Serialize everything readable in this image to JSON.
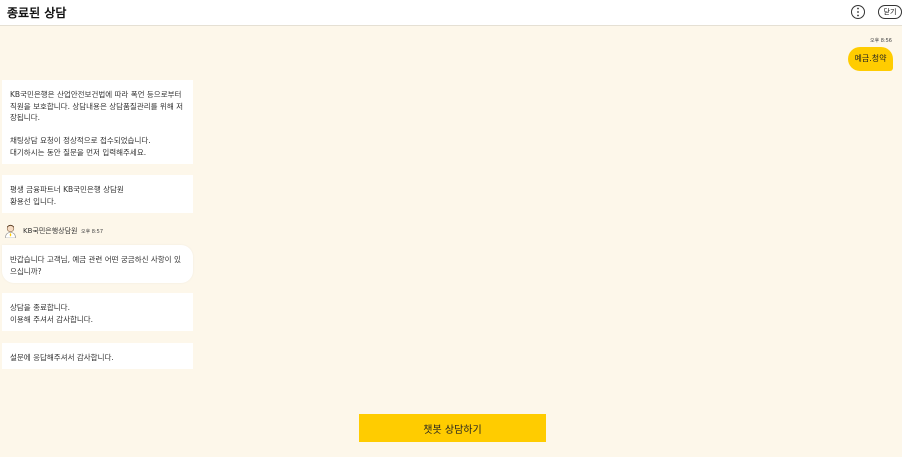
{
  "header": {
    "title": "종료된 상담",
    "close_label": "닫기"
  },
  "colors": {
    "accent": "#ffcc00",
    "background": "#fdf7ea"
  },
  "icons": {
    "more": "more-vertical-icon",
    "avatar": "agent-avatar-icon"
  },
  "chat": {
    "user_time": "오후 8:56",
    "user_message": "예금.청약",
    "bot_messages": [
      {
        "lines": [
          "KB국민은행은 산업안전보건법에 따라 폭언 등으로부터",
          "직원을 보호합니다. 상담내용은 상담품질관리를 위해 저",
          "장됩니다."
        ],
        "lines2": [
          "채팅상담 요청이 정상적으로 접수되었습니다.",
          "대기하시는 동안 질문을 먼저 입력해주세요."
        ]
      },
      {
        "lines": [
          "평생 금융파트너 KB국민은행 상담원",
          "황용선 입니다."
        ]
      }
    ],
    "agent": {
      "name": "KB국민은행상담원",
      "time": "오후 8:57"
    },
    "agent_messages": [
      {
        "lines": [
          "반갑습니다 고객님, 예금 관련 어떤 궁금하신 사항이 있",
          "으십니까?"
        ]
      },
      {
        "lines": [
          "상담을 종료합니다.",
          "이용해 주셔서 감사합니다."
        ]
      },
      {
        "lines": [
          "설문에 응답해주셔서 감사합니다."
        ]
      }
    ]
  },
  "footer": {
    "chatbot_button_label": "챗봇 상담하기"
  }
}
